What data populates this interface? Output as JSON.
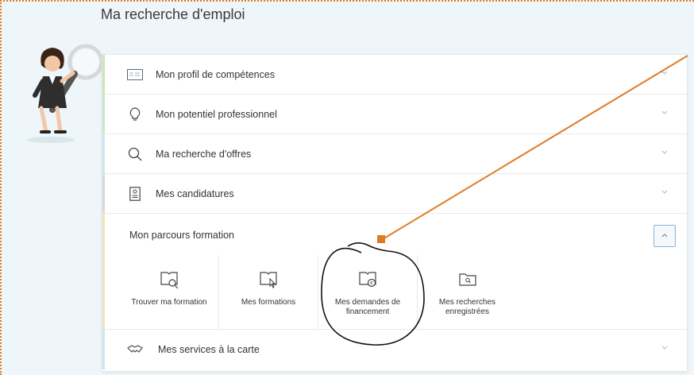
{
  "page": {
    "title": "Ma recherche d'emploi"
  },
  "accordion": [
    {
      "label": "Mon profil de compétences",
      "icon": "id-card-icon",
      "bar_color": "#cde6b6"
    },
    {
      "label": "Mon potentiel professionnel",
      "icon": "lightbulb-icon",
      "bar_color": "#cfe3cf"
    },
    {
      "label": "Ma recherche d'offres",
      "icon": "search-icon",
      "bar_color": "#cfe6ef"
    },
    {
      "label": "Mes candidatures",
      "icon": "document-icon",
      "bar_color": "#d8d8d8"
    }
  ],
  "formation": {
    "title": "Mon parcours formation",
    "bar_color": "#f3e3b8",
    "tiles": [
      {
        "label": "Trouver ma formation",
        "icon": "book-search-icon"
      },
      {
        "label": "Mes formations",
        "icon": "book-pointer-icon"
      },
      {
        "label": "Mes demandes de financement",
        "icon": "book-euro-icon"
      },
      {
        "label": "Mes recherches enregistrées",
        "icon": "folder-search-icon"
      }
    ]
  },
  "services": {
    "label": "Mes services à la carte",
    "icon": "handshake-icon",
    "bar_color": "#cfe6ef"
  },
  "colors": {
    "annotation": "#e07b25",
    "background": "#eef6fa",
    "accent": "#8fb4d6"
  }
}
